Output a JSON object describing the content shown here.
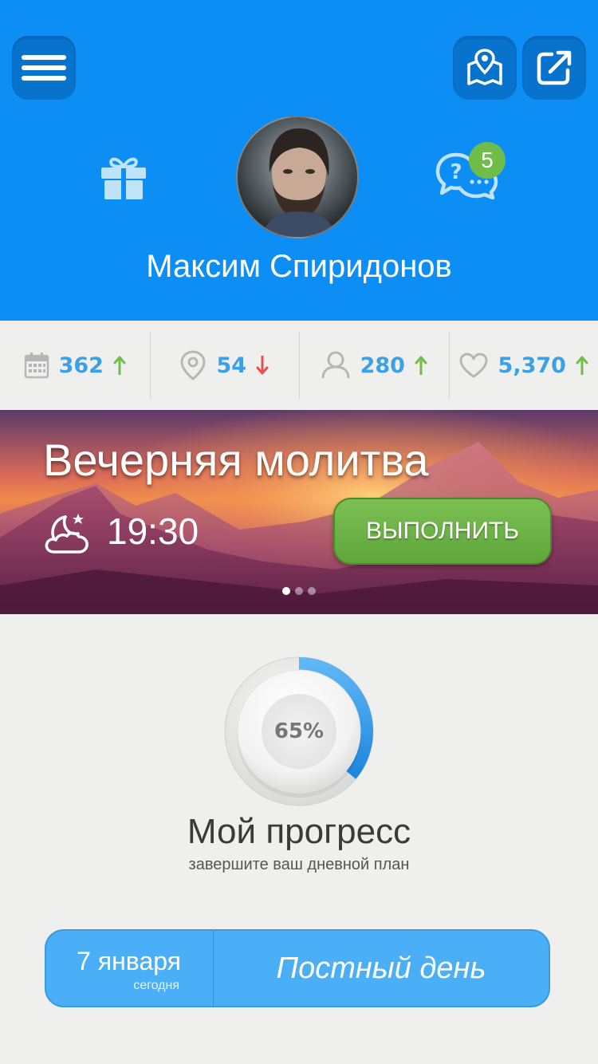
{
  "header": {
    "user_name": "Максим Спиридонов",
    "messages_badge": "5",
    "background_color": "#0d8ef5"
  },
  "icons": {
    "menu": "hamburger-icon",
    "map": "map-icon",
    "share": "share-icon",
    "gift": "gift-icon",
    "chat": "chat-question-icon"
  },
  "stats": [
    {
      "icon": "calendar-icon",
      "value": "362",
      "trend": "up"
    },
    {
      "icon": "location-pin-icon",
      "value": "54",
      "trend": "down"
    },
    {
      "icon": "user-icon",
      "value": "280",
      "trend": "up"
    },
    {
      "icon": "heart-icon",
      "value": "5,370",
      "trend": "up"
    }
  ],
  "banner": {
    "title": "Вечерняя молитва",
    "time": "19:30",
    "action_label": "ВЫПОЛНИТЬ",
    "slide_count": 3,
    "active_slide": 1
  },
  "progress": {
    "percent": 0.65,
    "percent_label": "65%",
    "title": "Мой прогресс",
    "subtitle": "завершите ваш дневной план"
  },
  "day": {
    "date": "7 января",
    "today_label": "сегодня",
    "name": "Постный день"
  },
  "colors": {
    "accent_blue": "#3ba0e6",
    "trend_up": "#6fbd48",
    "trend_down": "#e5524f",
    "action_green": "#6cb447"
  }
}
